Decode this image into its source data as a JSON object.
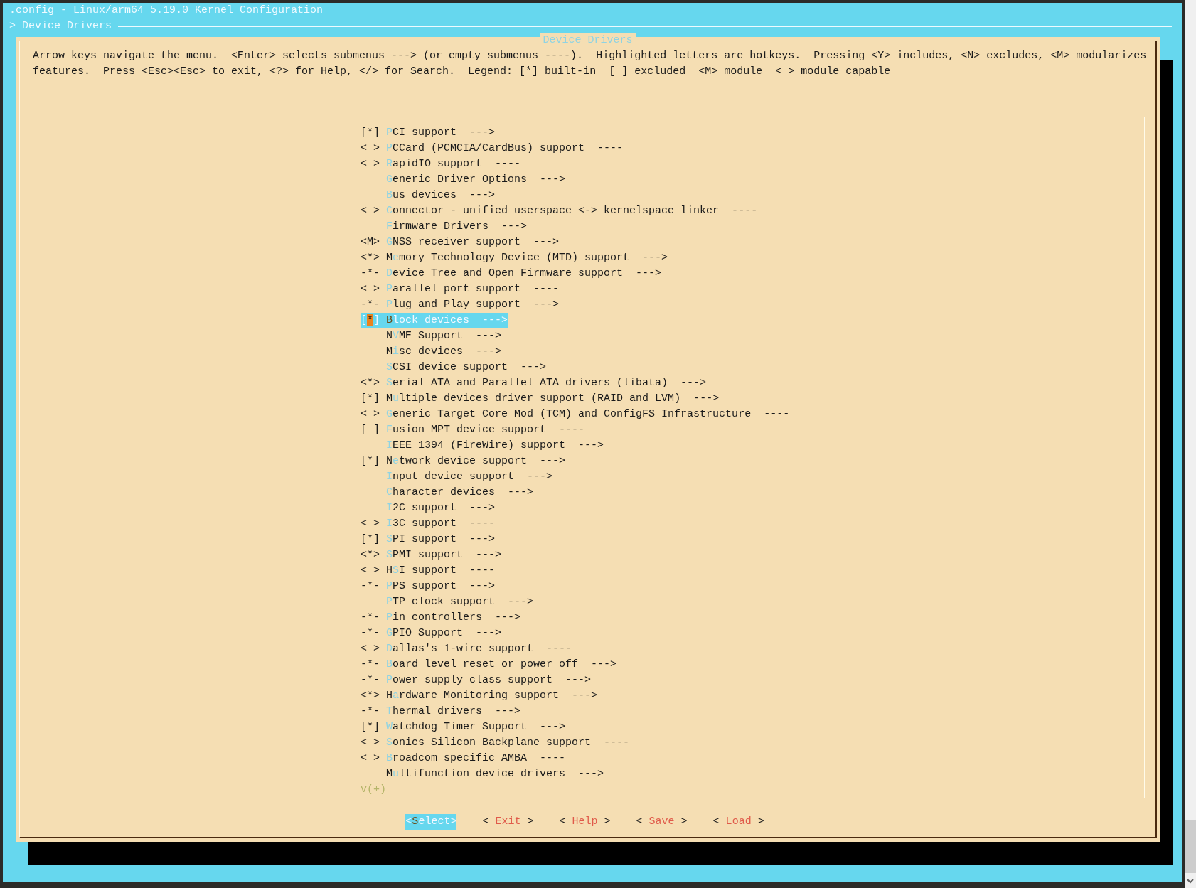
{
  "window": {
    "title": ".config - Linux/arm64 5.19.0 Kernel Configuration"
  },
  "breadcrumb": "> Device Drivers",
  "dialog": {
    "title": "Device Drivers",
    "help": [
      "Arrow keys navigate the menu.  <Enter> selects submenus ---> (or empty submenus ----).  Highlighted letters are hotkeys.  Pressing <Y> includes, <N> excludes, <M> modularizes",
      "features.  Press <Esc><Esc> to exit, <?> for Help, </> for Search.  Legend: [*] built-in  [ ] excluded  <M> module  < > module capable"
    ],
    "items": [
      {
        "prefix": "[*]",
        "hotkey": "P",
        "after": "CI support  --->",
        "selected": false
      },
      {
        "prefix": "< >",
        "hotkey": "P",
        "after": "CCard (PCMCIA/CardBus) support  ----",
        "selected": false
      },
      {
        "prefix": "< >",
        "hotkey": "R",
        "after": "apidIO support  ----",
        "selected": false
      },
      {
        "hotkey": "G",
        "after": "eneric Driver Options  --->",
        "selected": false
      },
      {
        "hotkey": "B",
        "after": "us devices  --->",
        "selected": false
      },
      {
        "prefix": "< >",
        "hotkey": "C",
        "after": "onnector - unified userspace <-> kernelspace linker  ----",
        "selected": false
      },
      {
        "hotkey": "F",
        "after": "irmware Drivers  --->",
        "selected": false
      },
      {
        "prefix": "<M>",
        "hotkey": "G",
        "after": "NSS receiver support  --->",
        "selected": false
      },
      {
        "prefix": "<*>",
        "before": "M",
        "hotkey": "e",
        "after": "mory Technology Device (MTD) support  --->",
        "selected": false
      },
      {
        "prefix": "-*-",
        "hotkey": "D",
        "after": "evice Tree and Open Firmware support  --->",
        "selected": false
      },
      {
        "prefix": "< >",
        "hotkey": "P",
        "after": "arallel port support  ----",
        "selected": false
      },
      {
        "prefix": "-*-",
        "hotkey": "P",
        "after": "lug and Play support  --->",
        "selected": false
      },
      {
        "prefix": "[*]",
        "hotkey": "B",
        "after": "lock devices  --->",
        "selected": true
      },
      {
        "before": "N",
        "hotkey": "V",
        "after": "ME Support  --->",
        "selected": false
      },
      {
        "before": "M",
        "hotkey": "i",
        "after": "sc devices  --->",
        "selected": false
      },
      {
        "hotkey": "S",
        "after": "CSI device support  --->",
        "selected": false
      },
      {
        "prefix": "<*>",
        "hotkey": "S",
        "after": "erial ATA and Parallel ATA drivers (libata)  --->",
        "selected": false
      },
      {
        "prefix": "[*]",
        "before": "M",
        "hotkey": "u",
        "after": "ltiple devices driver support (RAID and LVM)  --->",
        "selected": false
      },
      {
        "prefix": "< >",
        "hotkey": "G",
        "after": "eneric Target Core Mod (TCM) and ConfigFS Infrastructure  ----",
        "selected": false
      },
      {
        "prefix": "[ ]",
        "hotkey": "F",
        "after": "usion MPT device support  ----",
        "selected": false
      },
      {
        "hotkey": "I",
        "after": "EEE 1394 (FireWire) support  --->",
        "selected": false
      },
      {
        "prefix": "[*]",
        "before": "N",
        "hotkey": "e",
        "after": "twork device support  --->",
        "selected": false
      },
      {
        "hotkey": "I",
        "after": "nput device support  --->",
        "selected": false
      },
      {
        "hotkey": "C",
        "after": "haracter devices  --->",
        "selected": false
      },
      {
        "hotkey": "I",
        "after": "2C support  --->",
        "selected": false
      },
      {
        "prefix": "< >",
        "hotkey": "I",
        "after": "3C support  ----",
        "selected": false
      },
      {
        "prefix": "[*]",
        "hotkey": "S",
        "after": "PI support  --->",
        "selected": false
      },
      {
        "prefix": "<*>",
        "hotkey": "S",
        "after": "PMI support  --->",
        "selected": false
      },
      {
        "prefix": "< >",
        "before": "H",
        "hotkey": "S",
        "after": "I support  ----",
        "selected": false
      },
      {
        "prefix": "-*-",
        "hotkey": "P",
        "after": "PS support  --->",
        "selected": false
      },
      {
        "hotkey": "P",
        "after": "TP clock support  --->",
        "selected": false
      },
      {
        "prefix": "-*-",
        "hotkey": "P",
        "after": "in controllers  --->",
        "selected": false
      },
      {
        "prefix": "-*-",
        "hotkey": "G",
        "after": "PIO Support  --->",
        "selected": false
      },
      {
        "prefix": "< >",
        "hotkey": "D",
        "after": "allas's 1-wire support  ----",
        "selected": false
      },
      {
        "prefix": "-*-",
        "hotkey": "B",
        "after": "oard level reset or power off  --->",
        "selected": false
      },
      {
        "prefix": "-*-",
        "hotkey": "P",
        "after": "ower supply class support  --->",
        "selected": false
      },
      {
        "prefix": "<*>",
        "before": "H",
        "hotkey": "a",
        "after": "rdware Monitoring support  --->",
        "selected": false
      },
      {
        "prefix": "-*-",
        "hotkey": "T",
        "after": "hermal drivers  --->",
        "selected": false
      },
      {
        "prefix": "[*]",
        "hotkey": "W",
        "after": "atchdog Timer Support  --->",
        "selected": false
      },
      {
        "prefix": "< >",
        "hotkey": "S",
        "after": "onics Silicon Backplane support  ----",
        "selected": false
      },
      {
        "prefix": "< >",
        "hotkey": "B",
        "after": "roadcom specific AMBA  ----",
        "selected": false
      },
      {
        "before": "M",
        "hotkey": "u",
        "after": "ltifunction device drivers  --->",
        "selected": false
      }
    ],
    "more_indicator": "v(+)",
    "buttons": [
      {
        "left": "<",
        "hotkey": "S",
        "rest": "elect",
        "right": ">",
        "selected": true
      },
      {
        "left": "< ",
        "hotkey": "E",
        "rest": "xit",
        "right": " >",
        "selected": false
      },
      {
        "left": "< ",
        "hotkey": "H",
        "rest": "elp",
        "right": " >",
        "selected": false
      },
      {
        "left": "< ",
        "hotkey": "S",
        "rest": "ave",
        "right": " >",
        "selected": false
      },
      {
        "left": "< ",
        "hotkey": "L",
        "rest": "oad",
        "right": " >",
        "selected": false
      }
    ]
  }
}
